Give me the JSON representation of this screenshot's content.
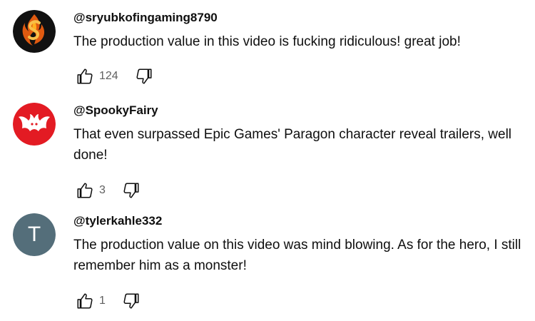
{
  "comments": [
    {
      "author": "@sryubkofingaming8790",
      "text": "The production value in this video is fucking ridiculous! great job!",
      "likes": "124",
      "avatar": "flaming-s-logo"
    },
    {
      "author": "@SpookyFairy",
      "text": "That even surpassed Epic Games' Paragon character reveal trailers, well done!",
      "likes": "3",
      "avatar": "red-bat-logo"
    },
    {
      "author": "@tylerkahle332",
      "text": "The production value on this video was mind blowing. As for the hero, I still remember him as a monster!",
      "likes": "1",
      "avatar_letter": "T",
      "avatar_color": "#546e7a"
    }
  ],
  "icons": {
    "like": "thumbs-up-icon",
    "dislike": "thumbs-down-icon"
  }
}
